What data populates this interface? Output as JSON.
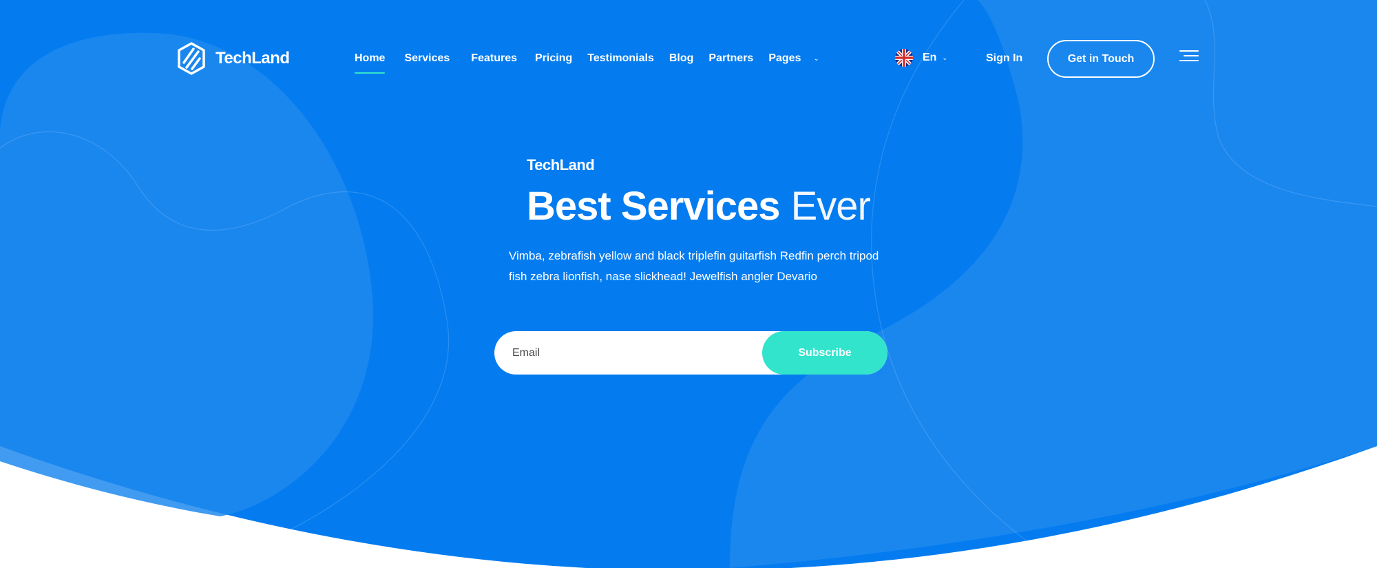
{
  "brand": {
    "name": "TechLand"
  },
  "nav": {
    "items": [
      {
        "label": "Home",
        "active": true
      },
      {
        "label": "Services"
      },
      {
        "label": "Features"
      },
      {
        "label": "Pricing"
      },
      {
        "label": "Testimonials"
      },
      {
        "label": "Blog"
      },
      {
        "label": "Partners"
      },
      {
        "label": "Pages"
      }
    ]
  },
  "language": {
    "current": "En",
    "flag_icon": "uk-flag-icon"
  },
  "header": {
    "signin_label": "Sign In",
    "cta_label": "Get in Touch",
    "menu_icon": "hamburger-menu-icon"
  },
  "hero": {
    "eyebrow": "TechLand",
    "headline_strong": "Best Services",
    "headline_light": "Ever",
    "description": "Vimba, zebrafish yellow and black triplefin guitarfish Redfin perch tripod fish zebra lionfish, nase slickhead! Jewelfish angler Devario"
  },
  "subscribe": {
    "placeholder": "Email",
    "button_label": "Subscribe"
  },
  "colors": {
    "primary": "#047cf0",
    "accent": "#33e4cd",
    "blob": "#1e8aee",
    "text": "#ffffff"
  }
}
